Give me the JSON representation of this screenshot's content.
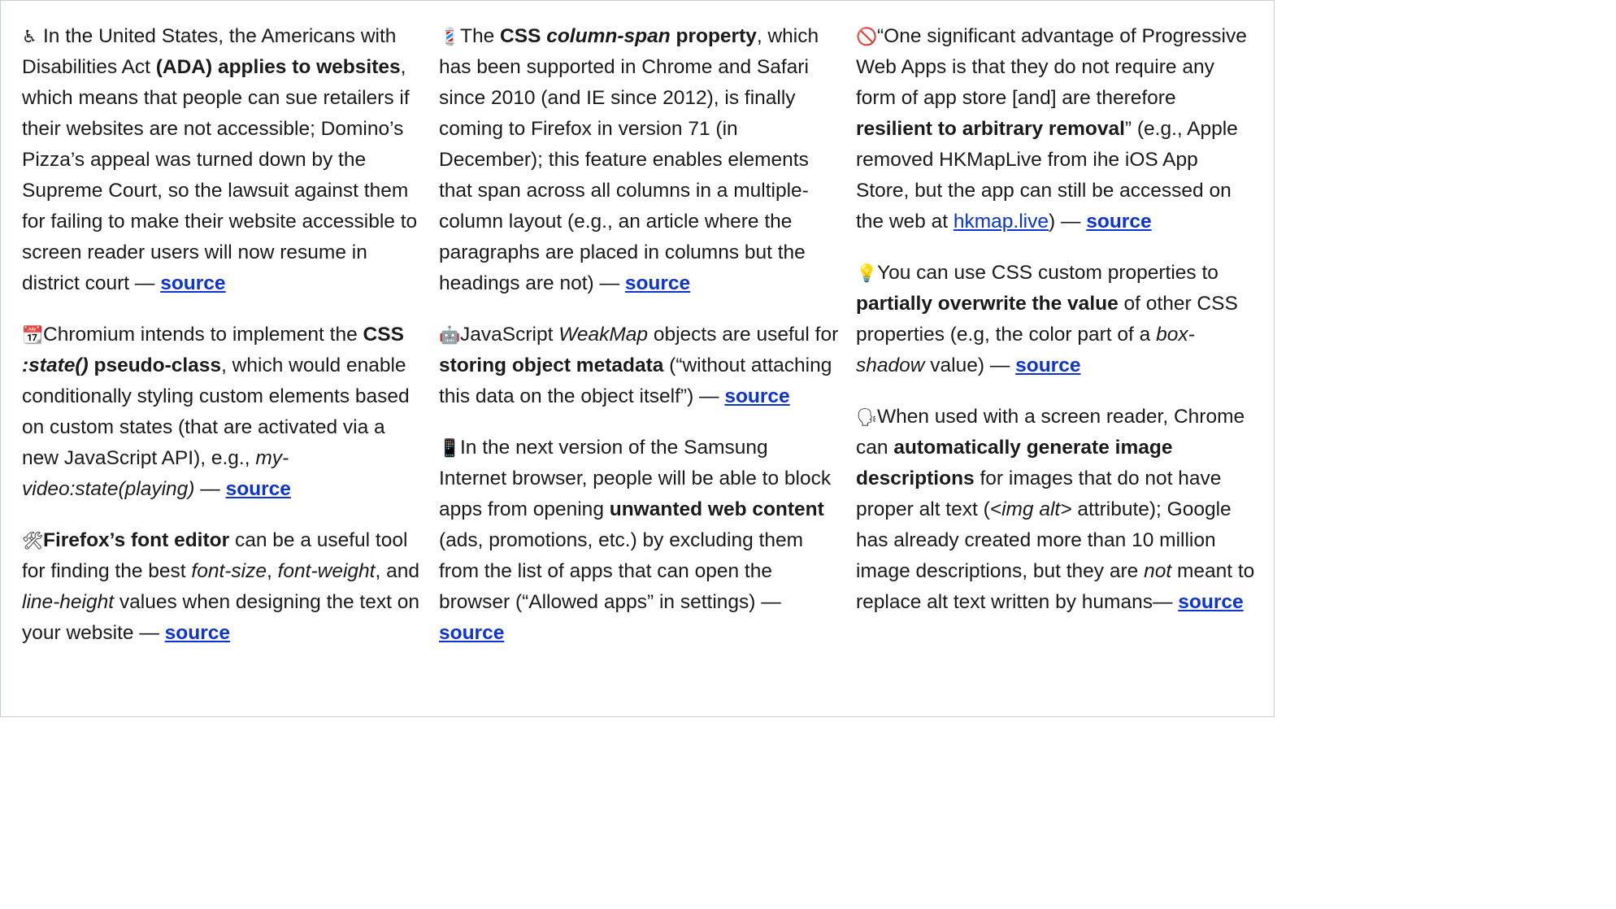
{
  "col1": [
    {
      "icon": "wheelchair-icon",
      "emoji": "♿",
      "t1": "In the United States, the Americans with Disabilities Act ",
      "b1": "(ADA) applies to websites",
      "t2": ", which means that people can sue retailers if their websites are not accessible; Domino’s Pizza’s appeal was turned down by the Supreme Court, so the lawsuit against them for failing to make their website accessible to screen reader users will now resume in district court — ",
      "source": "source"
    },
    {
      "icon": "calendar-icon",
      "emoji": "📆",
      "t1": "Chromium intends to implement the ",
      "b1": "CSS ",
      "bi1": ":state()",
      "b2": " pseudo-class",
      "t2": ", which would enable conditionally styling custom elements based on custom states (that are activated via a new JavaScript API), e.g., ",
      "i1": "my-video:state(playing)",
      "t3": " — ",
      "source": "source"
    },
    {
      "icon": "tools-icon",
      "emoji": "🛠",
      "b1": "Firefox’s font editor",
      "t1": " can be a useful tool for finding the best ",
      "i1": "font-size",
      "t2": ", ",
      "i2": "font-weight",
      "t3": ", and ",
      "i3": "line-height",
      "t4": " values when designing the text on your website — ",
      "source": "source"
    }
  ],
  "col2": [
    {
      "icon": "barber-pole-icon",
      "emoji": "💈",
      "t1": "The ",
      "b1": "CSS ",
      "bi1": "column-span",
      "b2": " property",
      "t2": ", which has been supported in Chrome and Safari since 2010 (and IE since 2012), is finally coming to Firefox in version 71 (in December); this feature enables elements that span across all columns in a multiple-column layout (e.g., an article where the paragraphs are placed in columns but the headings are not) — ",
      "source": "source"
    },
    {
      "icon": "robot-icon",
      "emoji": "🤖",
      "t1": "JavaScript ",
      "i1": "WeakMap",
      "t2": " objects are useful for ",
      "b1": "storing object metadata",
      "t3": " (“without attaching this data on the object itself”) — ",
      "source": "source "
    },
    {
      "icon": "mobile-phone-icon",
      "emoji": "📱",
      "t1": "In the next version of the Samsung Internet browser, people will be able to block apps from opening ",
      "b1": "unwanted web content",
      "t2": " (ads, promotions, etc.) by excluding them from the list of apps that can open the browser (“Allowed apps” in settings) — ",
      "source": "source"
    }
  ],
  "col3": [
    {
      "icon": "prohibited-icon",
      "emoji": "🚫",
      "t1": "“One significant advantage of Progressive Web Apps is that they do not require any form of app store [and] are therefore ",
      "b1": "resilient to arbitrary removal",
      "t2": "” (e.g., Apple removed HKMapLive from ihe iOS App Store, but the app can still be accessed on the web at ",
      "link": "hkmap.live",
      "t3": ") — ",
      "source": "source"
    },
    {
      "icon": "light-bulb-icon",
      "emoji": "💡",
      "t1": "You can use CSS custom properties to ",
      "b1": "partially overwrite the value",
      "t2": " of other CSS properties (e.g, the color part of a ",
      "i1": "box-shadow",
      "t3": " value) — ",
      "source": "source"
    },
    {
      "icon": "speaking-head-icon",
      "emoji": "🗣",
      "t1": "When used with a screen reader, Chrome can ",
      "b1": "automatically generate image descriptions",
      "t2": " for images that do not have proper alt text (",
      "i1": "<img alt>",
      "t3": " attribute); Google has already created more than 10 million image descriptions, but they are ",
      "i2": "not",
      "t4": " meant to replace alt text written by humans— ",
      "source": "source"
    }
  ]
}
